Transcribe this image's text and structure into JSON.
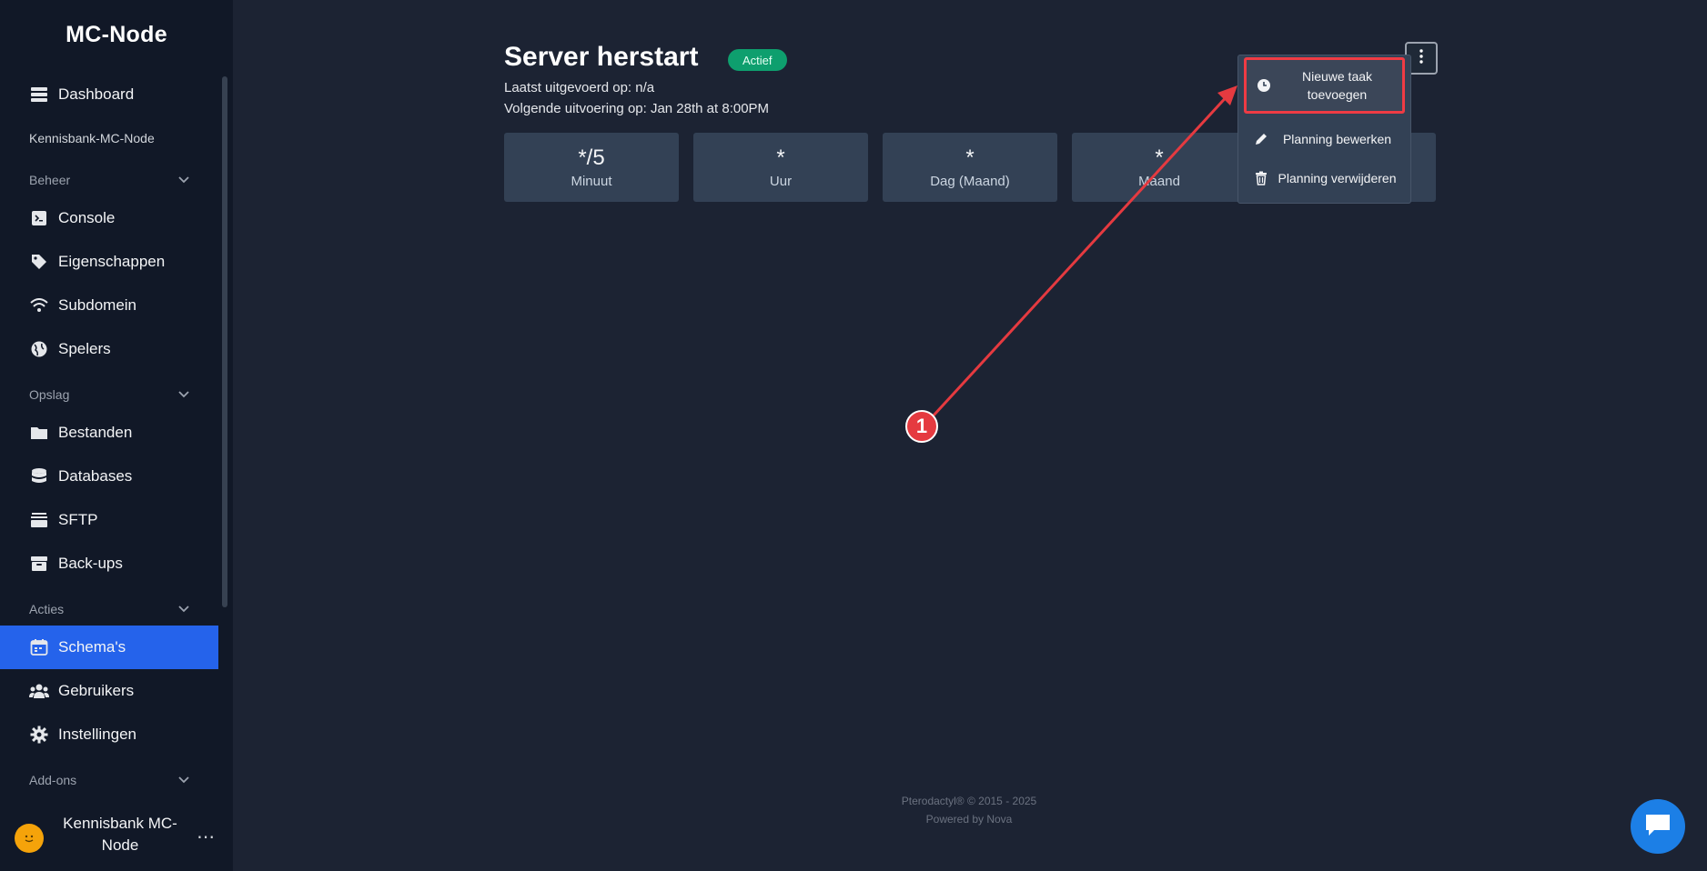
{
  "app": {
    "brand": "MC-Node",
    "server_label": "Kennisbank-MC-Node"
  },
  "sidebar": {
    "dashboard": "Dashboard",
    "sections": {
      "beheer": "Beheer",
      "opslag": "Opslag",
      "acties": "Acties",
      "addons": "Add-ons"
    },
    "beheer_items": [
      "Console",
      "Eigenschappen",
      "Subdomein",
      "Spelers"
    ],
    "opslag_items": [
      "Bestanden",
      "Databases",
      "SFTP",
      "Back-ups"
    ],
    "acties_items": [
      "Schema's",
      "Gebruikers",
      "Instellingen"
    ],
    "active_item": "Schema's"
  },
  "user": {
    "name": "Kennisbank MC-Node",
    "avatar_icon": "smiley-icon"
  },
  "schedule": {
    "title": "Server herstart",
    "status": "Actief",
    "last_run": "Laatst uitgevoerd op: n/a",
    "next_run": "Volgende uitvoering op: Jan 28th at 8:00PM",
    "cron": [
      {
        "value": "*/5",
        "label": "Minuut"
      },
      {
        "value": "*",
        "label": "Uur"
      },
      {
        "value": "*",
        "label": "Dag (Maand)"
      },
      {
        "value": "*",
        "label": "Maand"
      }
    ]
  },
  "menu": {
    "items": [
      {
        "label": "Nieuwe taak toevoegen",
        "icon": "clock-icon"
      },
      {
        "label": "Planning bewerken",
        "icon": "pencil-icon"
      },
      {
        "label": "Planning verwijderen",
        "icon": "trash-icon"
      }
    ]
  },
  "annotation": {
    "marker": "1"
  },
  "footer": {
    "line1": "Pterodactyl® © 2015 - 2025",
    "line2": "Powered by Nova"
  },
  "colors": {
    "accent": "#2563eb",
    "status": "#0e9f6e",
    "highlight": "#ef3b44",
    "chat": "#1c7fe6"
  }
}
